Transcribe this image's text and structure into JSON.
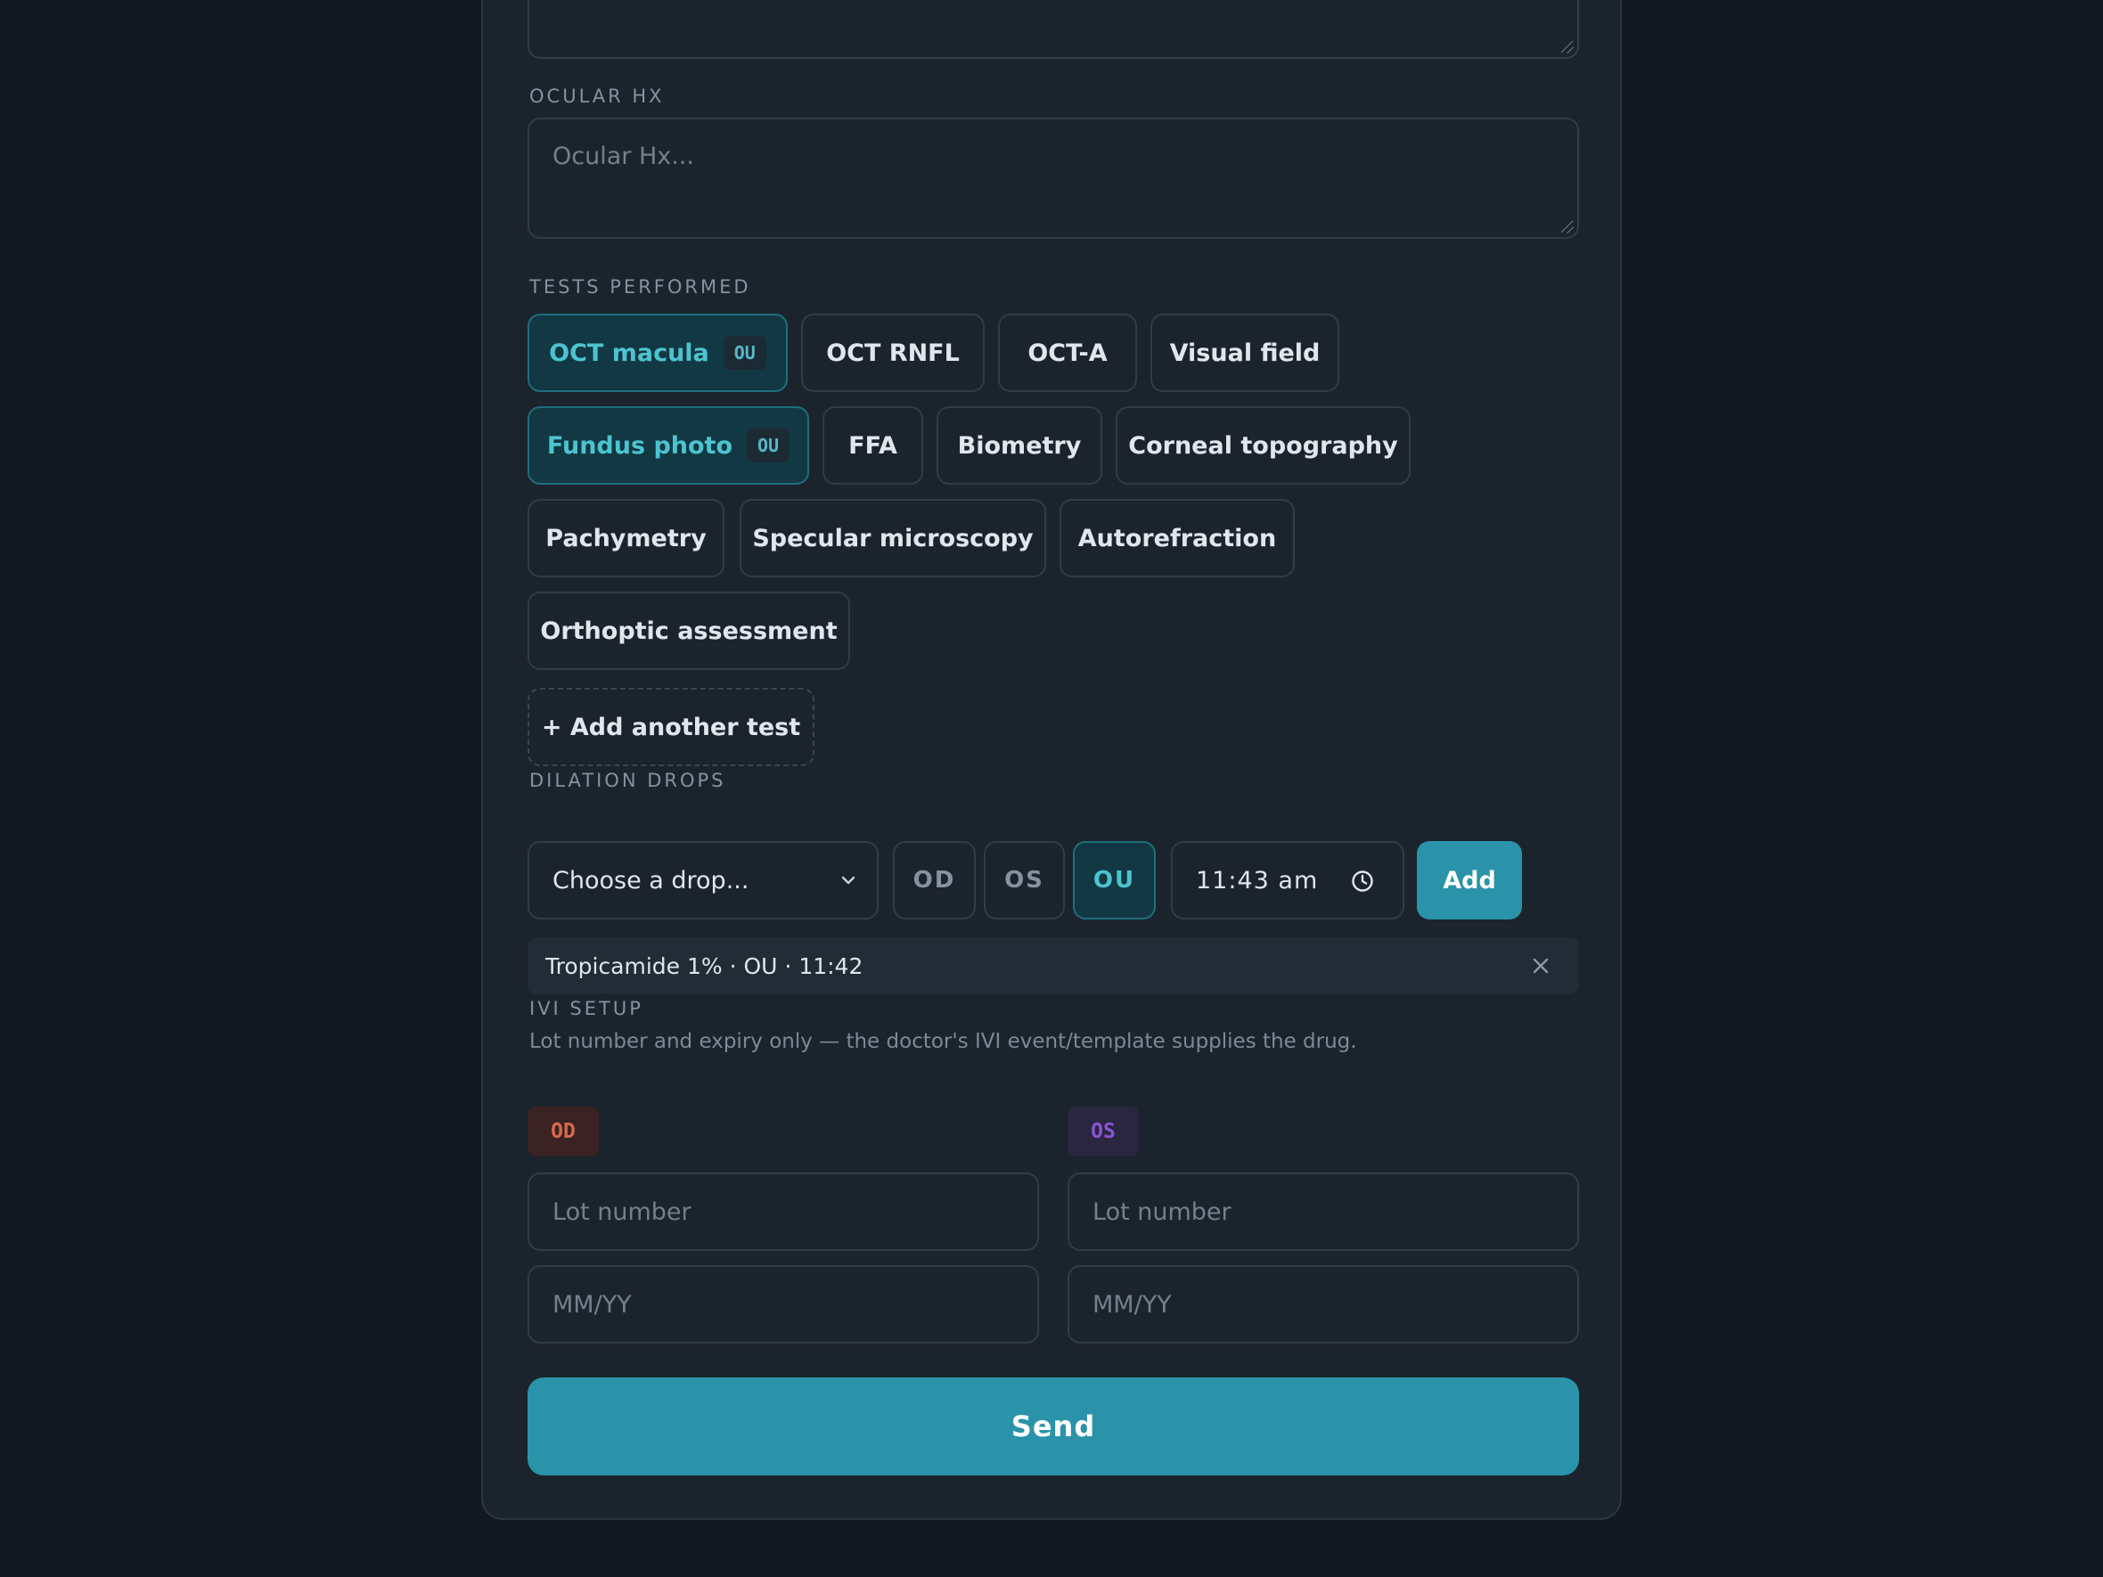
{
  "ocular_hx": {
    "label": "OCULAR HX",
    "placeholder": "Ocular Hx..."
  },
  "tests": {
    "label": "TESTS PERFORMED",
    "items": [
      {
        "name": "OCT macula",
        "selected": true,
        "eye": "OU"
      },
      {
        "name": "OCT RNFL",
        "selected": false
      },
      {
        "name": "OCT-A",
        "selected": false
      },
      {
        "name": "Visual field",
        "selected": false
      },
      {
        "name": "Fundus photo",
        "selected": true,
        "eye": "OU"
      },
      {
        "name": "FFA",
        "selected": false
      },
      {
        "name": "Biometry",
        "selected": false
      },
      {
        "name": "Corneal topography",
        "selected": false
      },
      {
        "name": "Pachymetry",
        "selected": false
      },
      {
        "name": "Specular microscopy",
        "selected": false
      },
      {
        "name": "Autorefraction",
        "selected": false
      },
      {
        "name": "Orthoptic assessment",
        "selected": false
      }
    ],
    "add_label": "+ Add another test"
  },
  "dilation": {
    "label": "DILATION DROPS",
    "drop_select": "Choose a drop...",
    "eyes": [
      "OD",
      "OS",
      "OU"
    ],
    "selected_eye": "OU",
    "time": "11:43 am",
    "add_label": "Add",
    "entries": [
      {
        "text": "Tropicamide 1% · OU · 11:42"
      }
    ]
  },
  "ivi": {
    "label": "IVI SETUP",
    "hint": "Lot number and expiry only — the doctor's IVI event/template supplies the drug.",
    "od": {
      "tag": "OD",
      "lot_placeholder": "Lot number",
      "expiry_placeholder": "MM/YY"
    },
    "os": {
      "tag": "OS",
      "lot_placeholder": "Lot number",
      "expiry_placeholder": "MM/YY"
    }
  },
  "send_label": "Send",
  "colors": {
    "accent": "#2a93a9",
    "selected_text": "#4cc4d0",
    "od": "#d9694f",
    "os": "#8a55d4"
  }
}
